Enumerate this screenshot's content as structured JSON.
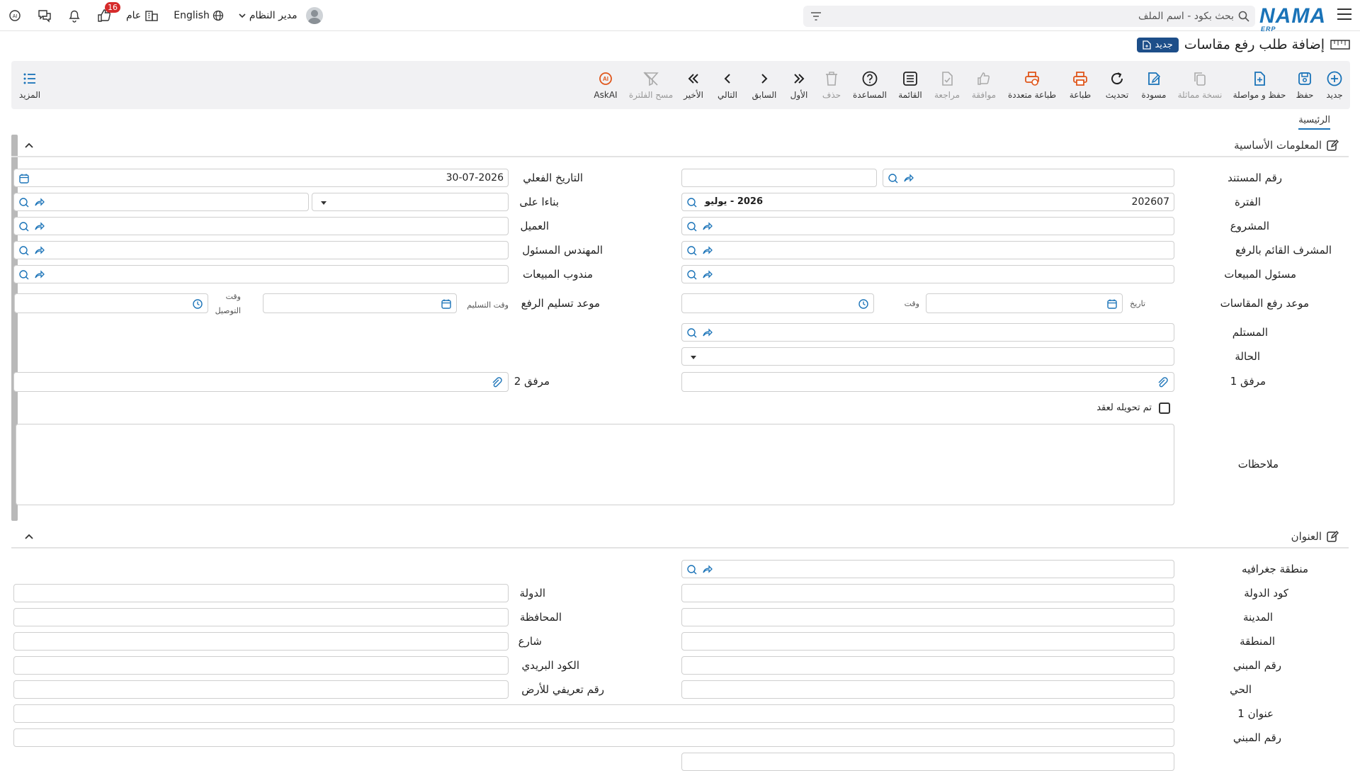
{
  "topbar": {
    "logo": "NAMA",
    "logo_sub": "ERP",
    "search_placeholder": "بحث بكود - اسم الملف",
    "user_name": "مدير النظام",
    "language": "English",
    "scope": "عام",
    "likes_badge": "16"
  },
  "page": {
    "title": "إضافة طلب رفع مقاسات",
    "new_badge": "جديد"
  },
  "toolbar": {
    "new": "جديد",
    "save": "حفظ",
    "save_continue": "حفظ و مواصلة",
    "copy": "نسخة مماثلة",
    "draft": "مسودة",
    "refresh": "تحديث",
    "print": "طباعة",
    "multi_print": "طباعة متعددة",
    "approve": "موافقة",
    "review": "مراجعة",
    "list": "القائمة",
    "help": "المساعدة",
    "delete": "حذف",
    "first": "الأول",
    "previous": "السابق",
    "next": "التالي",
    "last": "الأخير",
    "clear_filter": "مسح الفلترة",
    "askai": "AskAI",
    "more": "المزيد"
  },
  "tabs": {
    "main": "الرئيسية"
  },
  "basic": {
    "section_title": "المعلومات الأساسية",
    "doc_number": "رقم المستند",
    "actual_date": "التاريخ الفعلي",
    "actual_date_value": "30-07-2026",
    "period": "الفترة",
    "period_value": "202607",
    "period_chip": "2026 - يوليو",
    "based_on": "بناءا على",
    "project": "المشروع",
    "client": "العميل",
    "supervisor": "المشرف القائم بالرفع",
    "engineer": "المهندس المسئول",
    "sales_manager": "مسئول المبيعات",
    "sales_rep": "مندوب المبيعات",
    "measure_date": "موعد رفع المقاسات",
    "date_small": "تاريخ",
    "time_small": "وقت",
    "delivery_deadline": "موعد تسليم الرفع",
    "delivery_time_small": "وقت التسليم",
    "connect_time_small_1": "وقت",
    "connect_time_small_2": "التوصيل",
    "receiver": "المستلم",
    "status": "الحالة",
    "attachment1": "مرفق 1",
    "attachment2": "مرفق 2",
    "converted": "تم تحويله لعقد",
    "notes": "ملاحظات"
  },
  "address": {
    "section_title": "العنوان",
    "geo_region": "منطقة جغرافيه",
    "country_code": "كود الدولة",
    "country": "الدولة",
    "city": "المدينة",
    "province": "المحافظة",
    "area": "المنطقة",
    "street": "شارع",
    "building_no": "رقم المبني",
    "postal_code": "الكود البريدي",
    "district": "الحي",
    "land_id": "رقم تعريفي للأرض",
    "address1": "عنوان 1",
    "building_no_2": "رقم المبني"
  }
}
